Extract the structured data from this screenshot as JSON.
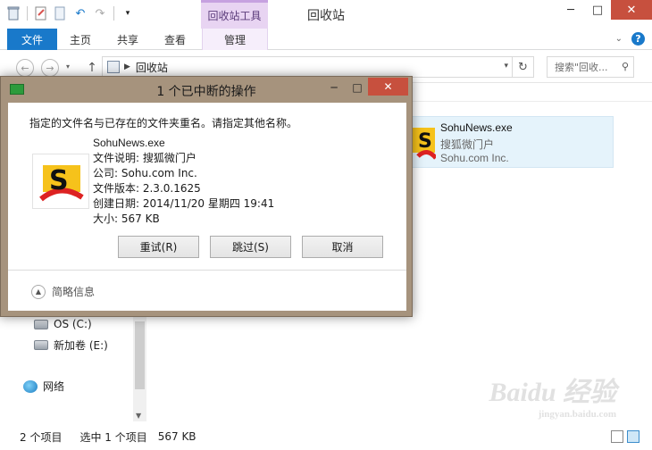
{
  "explorer": {
    "title": "回收站",
    "context_tab_header": "回收站工具",
    "ribbon_tabs": [
      "文件",
      "主页",
      "共享",
      "查看",
      "管理"
    ],
    "address": {
      "crumb": "回收站"
    },
    "search_placeholder": "搜索\"回收...",
    "item": {
      "name": "SohuNews.exe",
      "description": "搜狐微门户",
      "company": "Sohu.com Inc."
    },
    "nav": {
      "drive_c": "OS (C:)",
      "drive_e": "新加卷 (E:)",
      "network": "网络"
    },
    "status": {
      "count": "2 个项目",
      "selected": "选中 1 个项目",
      "size": "567 KB"
    },
    "watermark": "Baidu 经验",
    "watermark_url": "jingyan.baidu.com"
  },
  "dialog": {
    "title": "1 个已中断的操作",
    "message": "指定的文件名与已存在的文件夹重名。请指定其他名称。",
    "file": {
      "name": "SohuNews.exe",
      "description": "文件说明: 搜狐微门户",
      "company": "公司: Sohu.com Inc.",
      "version": "文件版本: 2.3.0.1625",
      "created": "创建日期: 2014/11/20 星期四 19:41",
      "size": "大小: 567 KB"
    },
    "buttons": {
      "retry": "重试(R)",
      "skip": "跳过(S)",
      "cancel": "取消"
    },
    "details_toggle": "简略信息"
  },
  "colors": {
    "accent_blue": "#1979ca",
    "close_red": "#c7503e",
    "dialog_frame": "#a6937d",
    "context_tab": "#e8d4f2"
  }
}
